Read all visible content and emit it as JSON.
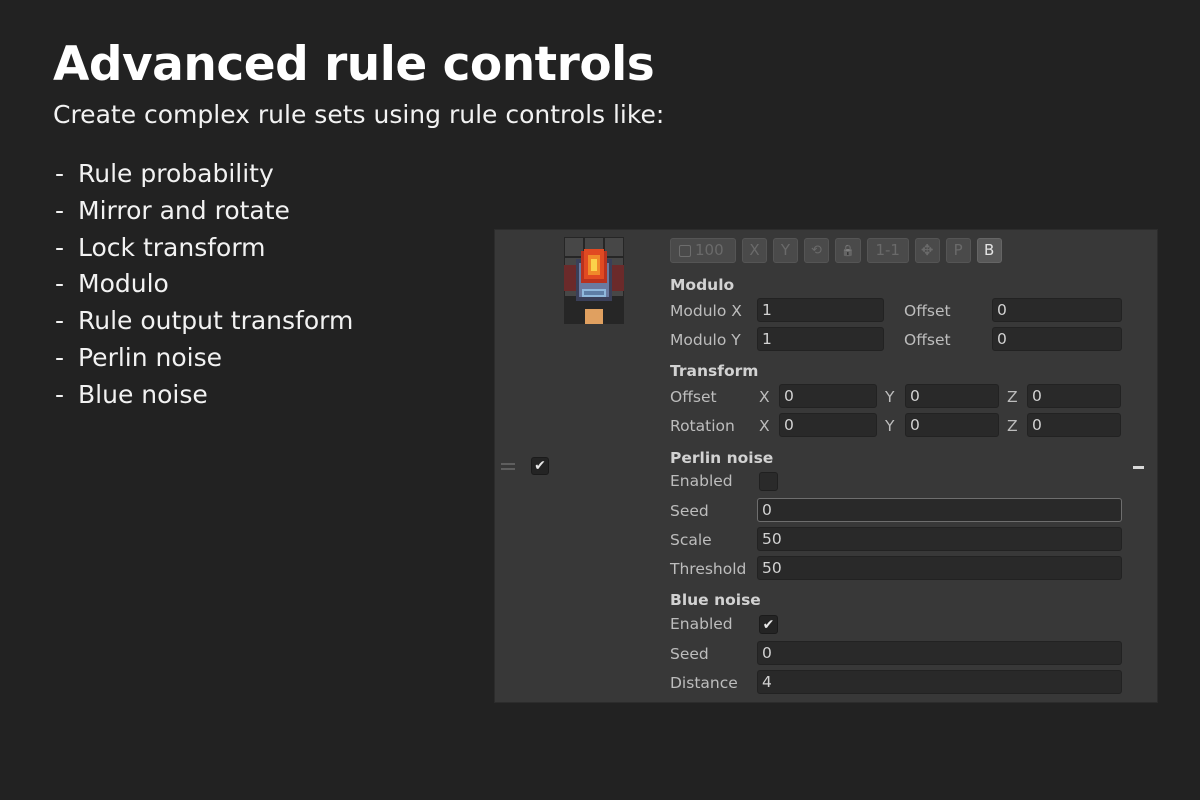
{
  "heading": {
    "title": "Advanced rule controls",
    "subtitle": "Create complex rule sets using rule controls like:"
  },
  "features": [
    "Rule probability",
    "Mirror and rotate",
    "Lock transform",
    "Modulo",
    "Rule output transform",
    "Perlin noise",
    "Blue noise"
  ],
  "feature_dash": "-",
  "panel": {
    "rule_enabled_check": "✔",
    "toolbar": {
      "probability": "100",
      "mirror_x": "X",
      "mirror_y": "Y",
      "rotate": "⟲",
      "lock": "🔒",
      "scale": "1-1",
      "move": "✥",
      "perlin": "P",
      "blue": "B"
    },
    "modulo": {
      "title": "Modulo",
      "modulo_x_label": "Modulo X",
      "modulo_x_value": "1",
      "modulo_x_offset_label": "Offset",
      "modulo_x_offset_value": "0",
      "modulo_y_label": "Modulo Y",
      "modulo_y_value": "1",
      "modulo_y_offset_label": "Offset",
      "modulo_y_offset_value": "0"
    },
    "transform": {
      "title": "Transform",
      "offset_label": "Offset",
      "rotation_label": "Rotation",
      "axis_x": "X",
      "axis_y": "Y",
      "axis_z": "Z",
      "offset": {
        "x": "0",
        "y": "0",
        "z": "0"
      },
      "rotation": {
        "x": "0",
        "y": "0",
        "z": "0"
      }
    },
    "perlin": {
      "title": "Perlin noise",
      "enabled_label": "Enabled",
      "enabled": false,
      "seed_label": "Seed",
      "seed_value": "0",
      "scale_label": "Scale",
      "scale_value": "50",
      "threshold_label": "Threshold",
      "threshold_value": "50"
    },
    "blue": {
      "title": "Blue noise",
      "enabled_label": "Enabled",
      "enabled": true,
      "enabled_check": "✔",
      "seed_label": "Seed",
      "seed_value": "0",
      "distance_label": "Distance",
      "distance_value": "4"
    }
  }
}
